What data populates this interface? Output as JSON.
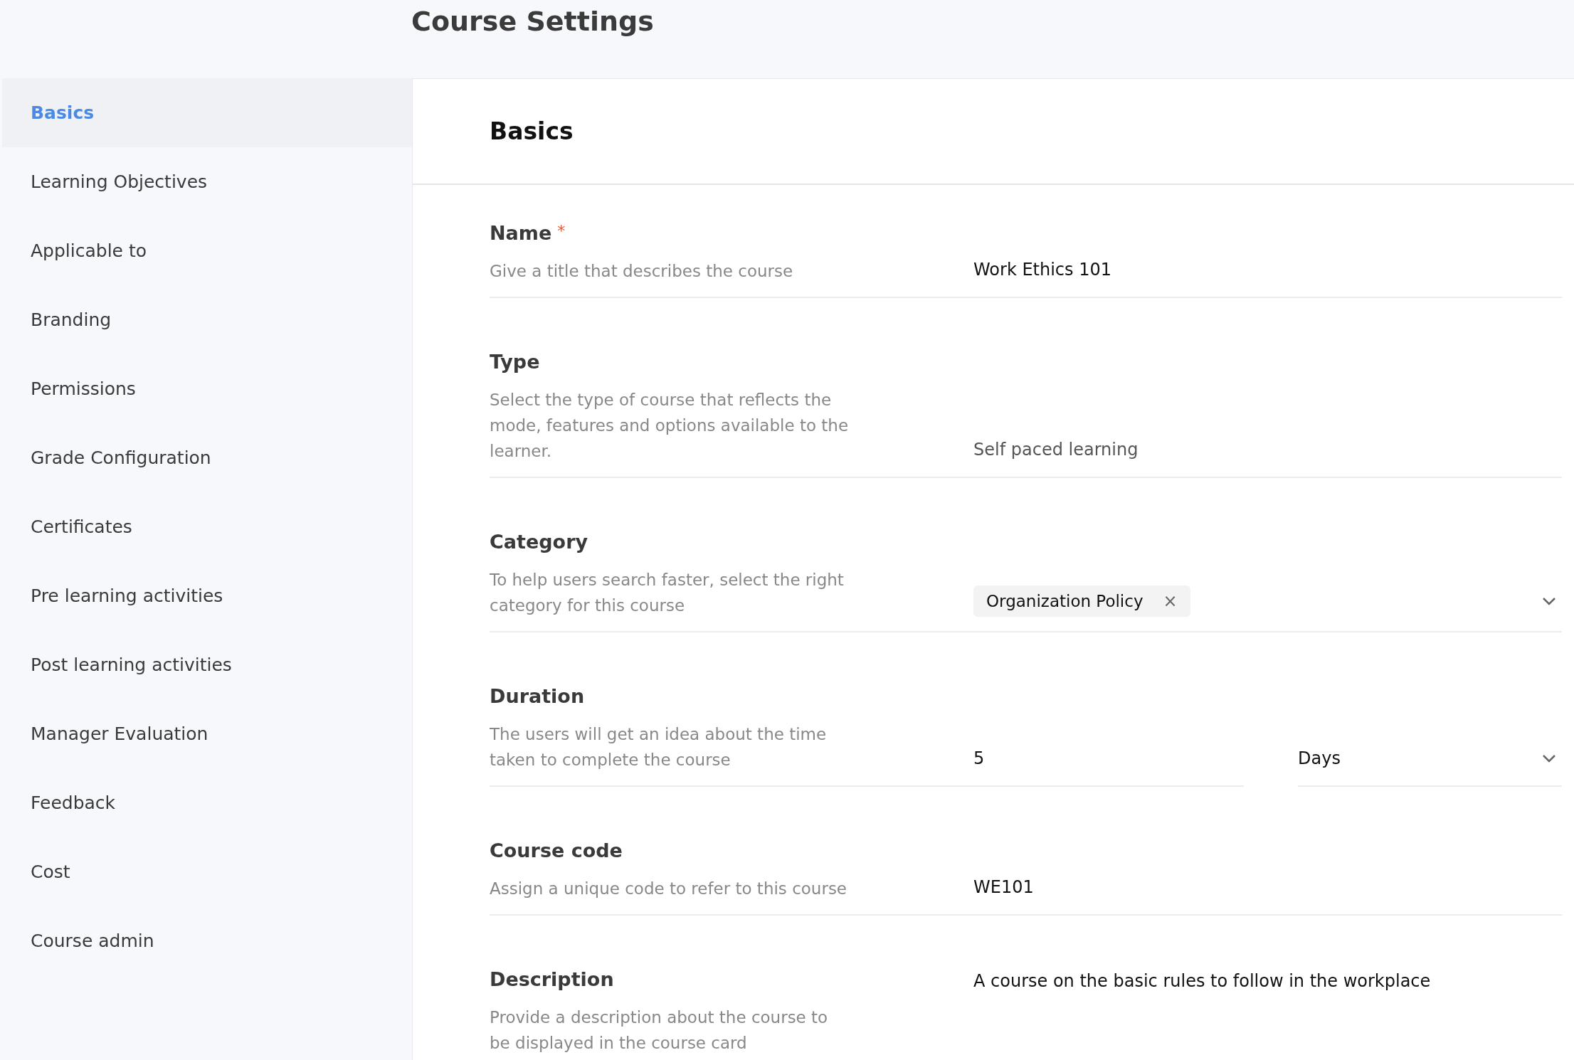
{
  "page_title": "Course Settings",
  "sidebar": {
    "items": [
      {
        "label": "Basics",
        "selected": true
      },
      {
        "label": "Learning Objectives",
        "selected": false
      },
      {
        "label": "Applicable to",
        "selected": false
      },
      {
        "label": "Branding",
        "selected": false
      },
      {
        "label": "Permissions",
        "selected": false
      },
      {
        "label": "Grade Configuration",
        "selected": false
      },
      {
        "label": "Certificates",
        "selected": false
      },
      {
        "label": "Pre learning activities",
        "selected": false
      },
      {
        "label": "Post learning activities",
        "selected": false
      },
      {
        "label": "Manager Evaluation",
        "selected": false
      },
      {
        "label": "Feedback",
        "selected": false
      },
      {
        "label": "Cost",
        "selected": false
      },
      {
        "label": "Course admin",
        "selected": false
      }
    ]
  },
  "section": {
    "title": "Basics",
    "fields": [
      {
        "kind": "text",
        "label": "Name",
        "required_mark": "*",
        "description": "Give a title that describes the course",
        "value": "Work Ethics 101",
        "disabled": false
      },
      {
        "kind": "text",
        "label": "Type",
        "description": "Select the type of course that reflects the mode, features and options available to the learner.",
        "value": "Self paced learning",
        "disabled": true
      },
      {
        "kind": "chips",
        "label": "Category",
        "description": "To help users search faster, select the right category for this course",
        "chips": [
          {
            "label": "Organization Policy",
            "remove": "×"
          }
        ]
      },
      {
        "kind": "duration",
        "label": "Duration",
        "description": "The users will get an idea about the time taken to complete the course",
        "value": "5",
        "unit": "Days"
      },
      {
        "kind": "text",
        "label": "Course code",
        "description": "Assign a unique code to refer to this course",
        "value": "WE101",
        "disabled": false
      },
      {
        "kind": "textarea",
        "label": "Description",
        "description": "Provide a description about the course to be displayed in the course card",
        "value": "A course on the basic rules to follow in the workplace"
      }
    ]
  }
}
